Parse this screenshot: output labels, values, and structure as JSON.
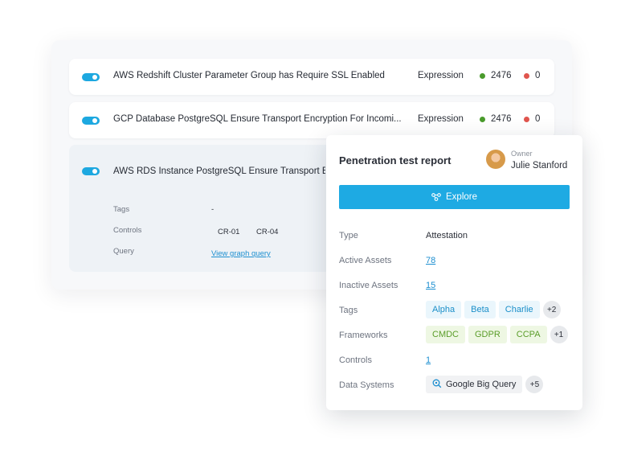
{
  "rules": [
    {
      "title": "AWS Redshift Cluster Parameter Group has Require SSL Enabled",
      "type": "Expression",
      "pass": "2476",
      "fail": "0"
    },
    {
      "title": "GCP Database PostgreSQL Ensure Transport Encryption For Incomi...",
      "type": "Expression",
      "pass": "2476",
      "fail": "0"
    },
    {
      "title": "AWS RDS Instance PostgreSQL Ensure Transport Encryption"
    }
  ],
  "details": {
    "tags_label": "Tags",
    "tags_value": "-",
    "controls_label": "Controls",
    "controls": [
      "CR-01",
      "CR-04"
    ],
    "query_label": "Query",
    "query_link": "View graph query"
  },
  "card": {
    "title": "Penetration test report",
    "owner_label": "Owner",
    "owner_name": "Julie Stanford",
    "explore_label": "Explore",
    "type_label": "Type",
    "type_value": "Attestation",
    "active_label": "Active Assets",
    "active_value": "78",
    "inactive_label": "Inactive Assets",
    "inactive_value": "15",
    "tags_label": "Tags",
    "tags": [
      "Alpha",
      "Beta",
      "Charlie"
    ],
    "tags_more": "+2",
    "frameworks_label": "Frameworks",
    "frameworks": [
      "CMDC",
      "GDPR",
      "CCPA"
    ],
    "frameworks_more": "+1",
    "controls_label": "Controls",
    "controls_value": "1",
    "data_systems_label": "Data Systems",
    "data_system": "Google Big Query",
    "data_systems_more": "+5"
  },
  "colors": {
    "accent": "#1eaae3",
    "pass": "#4a9b2c",
    "fail": "#e0554e"
  }
}
